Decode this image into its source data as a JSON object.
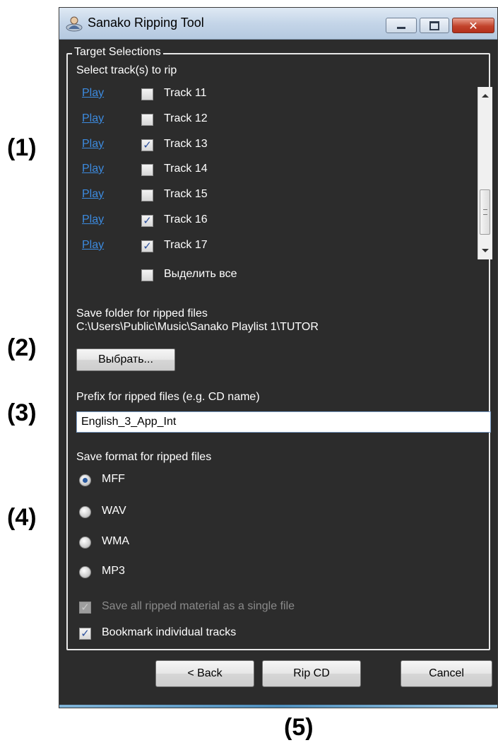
{
  "callouts": [
    "(1)",
    "(2)",
    "(3)",
    "(4)",
    "(5)"
  ],
  "window": {
    "title": "Sanako Ripping Tool"
  },
  "group": {
    "legend": "Target Selections"
  },
  "tracks": {
    "label": "Select track(s) to rip",
    "play_label": "Play",
    "items": [
      {
        "name": "Track 11",
        "checked": false
      },
      {
        "name": "Track 12",
        "checked": false
      },
      {
        "name": "Track 13",
        "checked": true
      },
      {
        "name": "Track 14",
        "checked": false
      },
      {
        "name": "Track 15",
        "checked": false
      },
      {
        "name": "Track 16",
        "checked": true
      },
      {
        "name": "Track 17",
        "checked": true
      }
    ],
    "select_all_label": "Выделить все",
    "select_all_checked": false
  },
  "folder": {
    "label": "Save folder for ripped files",
    "path": "C:\\Users\\Public\\Music\\Sanako Playlist 1\\TUTOR",
    "choose_button": "Выбрать..."
  },
  "prefix": {
    "label": "Prefix for ripped files (e.g. CD name)",
    "value": "English_3_App_Int"
  },
  "format": {
    "label": "Save format for ripped files",
    "options": [
      "MFF",
      "WAV",
      "WMA",
      "MP3"
    ],
    "selected": "MFF"
  },
  "options": {
    "single_file_label": "Save all ripped material as a single file",
    "single_file_checked": true,
    "single_file_enabled": false,
    "bookmark_label": "Bookmark individual tracks",
    "bookmark_checked": true
  },
  "buttons": {
    "back": "< Back",
    "rip": "Rip CD",
    "cancel": "Cancel"
  },
  "colors": {
    "window_bg": "#2c2c2c",
    "link": "#3c8be0",
    "check_mark": "#2b4f9c"
  }
}
